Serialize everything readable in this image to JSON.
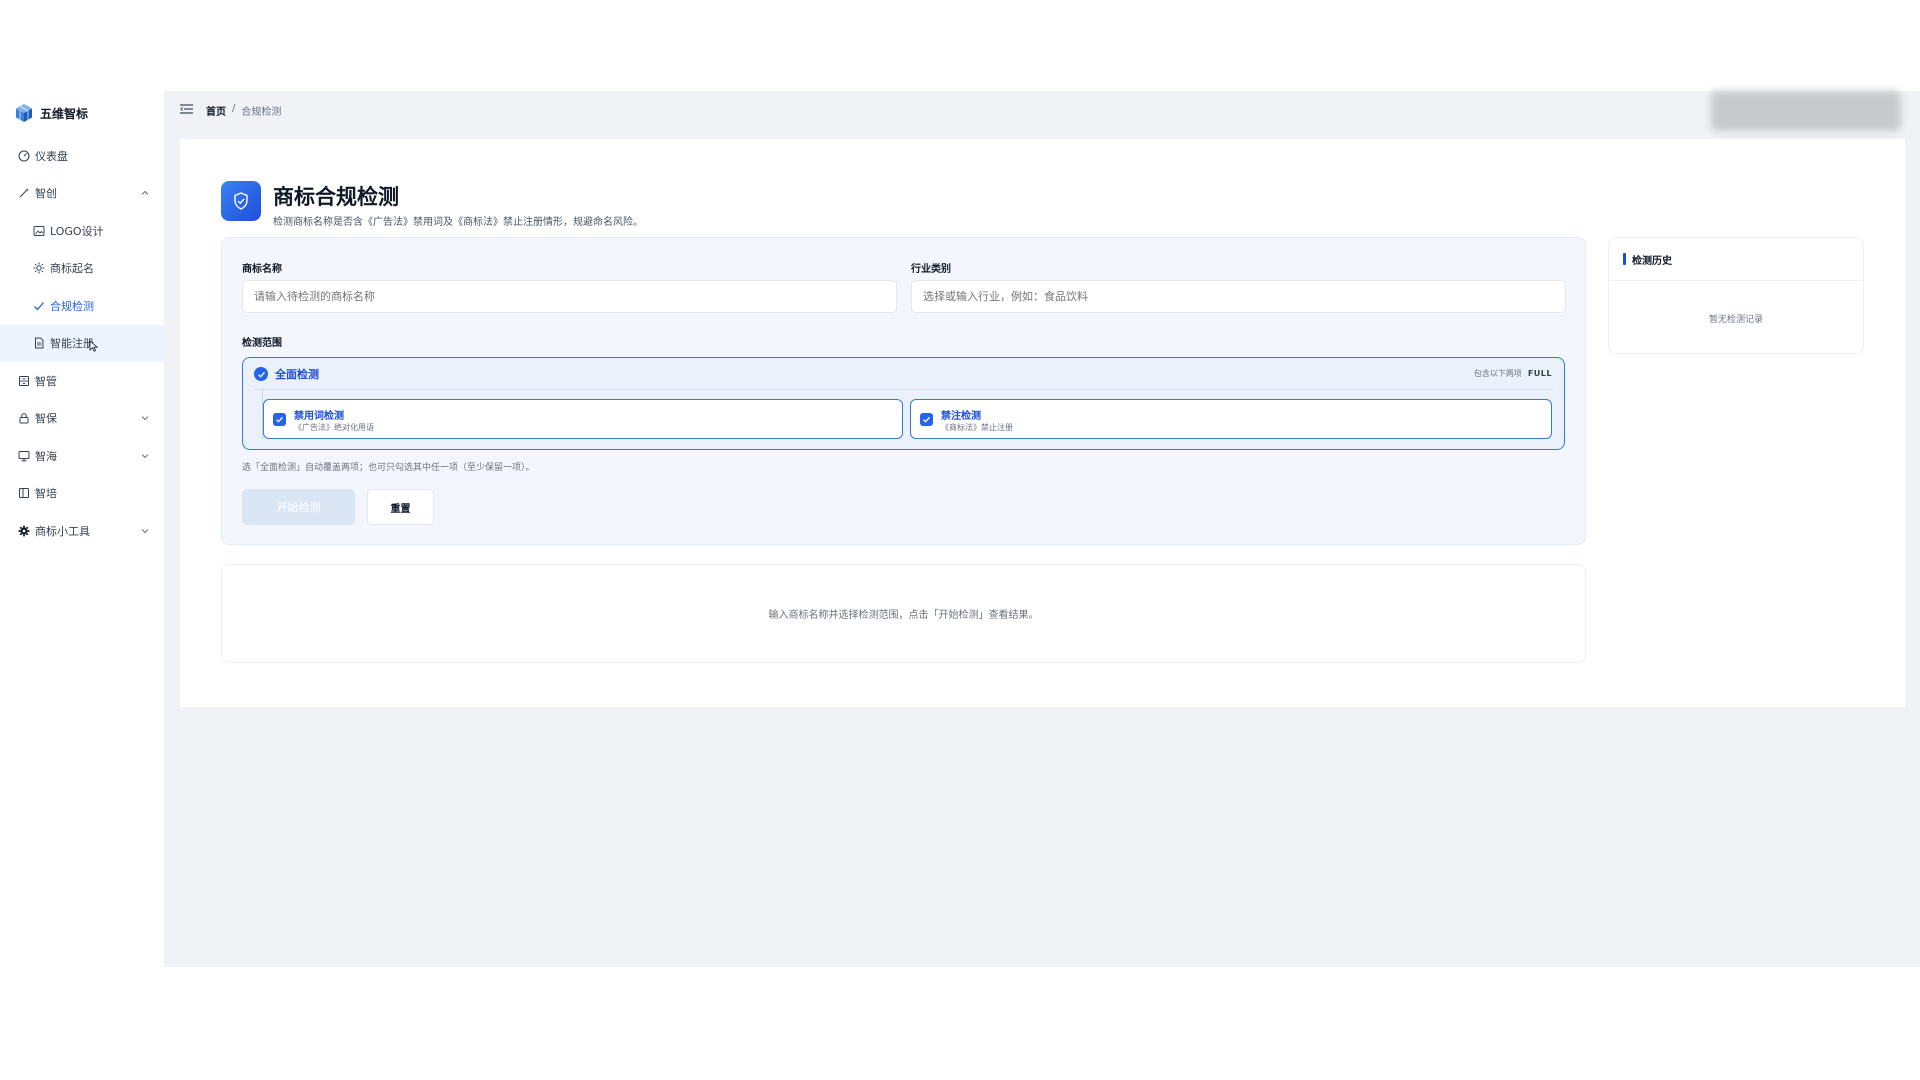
{
  "brand": {
    "name": "五维智标"
  },
  "sidebar": {
    "items": [
      {
        "label": "仪表盘",
        "icon": "dashboard-icon"
      },
      {
        "label": "智创",
        "icon": "magic-wand-icon",
        "expanded": true
      },
      {
        "label": "LOGO设计",
        "icon": "image-icon"
      },
      {
        "label": "商标起名",
        "icon": "sparkle-icon"
      },
      {
        "label": "合规检测",
        "icon": "check-icon",
        "active": true
      },
      {
        "label": "智能注册",
        "icon": "document-icon"
      },
      {
        "label": "智管",
        "icon": "archive-icon"
      },
      {
        "label": "智保",
        "icon": "lock-icon",
        "expanded": false
      },
      {
        "label": "智海",
        "icon": "monitor-icon",
        "expanded": false
      },
      {
        "label": "智培",
        "icon": "book-icon"
      },
      {
        "label": "商标小工具",
        "icon": "gear-icon",
        "expanded": false
      }
    ]
  },
  "breadcrumb": {
    "home": "首页",
    "separator": "/",
    "current": "合规检测"
  },
  "page": {
    "title": "商标合规检测",
    "subtitle": "检测商标名称是否含《广告法》禁用词及《商标法》禁止注册情形，规避命名风险。"
  },
  "form": {
    "name_label": "商标名称",
    "name_placeholder": "请输入待检测的商标名称",
    "industry_label": "行业类别",
    "industry_placeholder": "选择或输入行业，例如：食品饮料",
    "scope_label": "检测范围",
    "scope_all_label": "全面检测",
    "scope_all_hint": "包含以下两项",
    "scope_all_tag": "FULL",
    "options": [
      {
        "title": "禁用词检测",
        "desc": "《广告法》绝对化用语"
      },
      {
        "title": "禁注检测",
        "desc": "《商标法》禁止注册"
      }
    ],
    "scope_hint": "选「全面检测」自动覆盖两项；也可只勾选其中任一项（至少保留一项）。",
    "start_button": "开始检测",
    "reset_button": "重置"
  },
  "result": {
    "empty_text": "输入商标名称并选择检测范围，点击「开始检测」查看结果。"
  },
  "history": {
    "title": "检测历史",
    "empty_text": "暂无检测记录"
  },
  "colors": {
    "accent": "#2563eb",
    "panel_bg": "#f3f7fd",
    "page_bg": "#f0f2f6"
  }
}
